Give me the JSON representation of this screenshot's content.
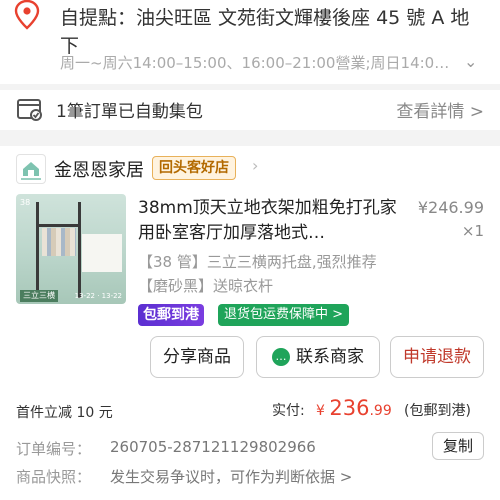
{
  "pickup": {
    "address": "自提點：油尖旺區 文苑街文輝樓後座 45 號 A 地下",
    "hours": "周一~周六14:00–15:00、16:00–21:00營業;周日14:0…"
  },
  "batch": {
    "label": "1筆訂單已自動集包",
    "detail_link": "查看詳情 >"
  },
  "shop": {
    "name": "金恩恩家居",
    "badge": "回头客好店",
    "logo_text": "金恩恩家居"
  },
  "item": {
    "title": "38mm顶天立地衣架加粗免打孔家用卧室客厅加厚落地式…",
    "price": "¥246.99",
    "quantity": "×1",
    "spec": "【38 管】三立三横两托盘,强烈推荐【磨砂黑】送晾衣杆",
    "tag_free": "包郵到港",
    "tag_return": "退货包运费保障中 >"
  },
  "actions": {
    "share": "分享商品",
    "chat": "联系商家",
    "refund": "申请退款"
  },
  "summary": {
    "discount": "首件立减 10 元",
    "paid_label": "实付:",
    "currency": "¥",
    "amount_int": "236",
    "amount_dec": ".99",
    "note": "(包郵到港)"
  },
  "details": {
    "order_label": "订单编号：",
    "order_no": "260705-287121129802966",
    "copy": "复制",
    "snapshot_label": "商品快照：",
    "snapshot_value": "发生交易争议时，可作为判断依据 >"
  },
  "colors": {
    "accent_red": "#e8412f",
    "free_purple": "#5b2fd1",
    "return_green": "#1fa45a"
  }
}
